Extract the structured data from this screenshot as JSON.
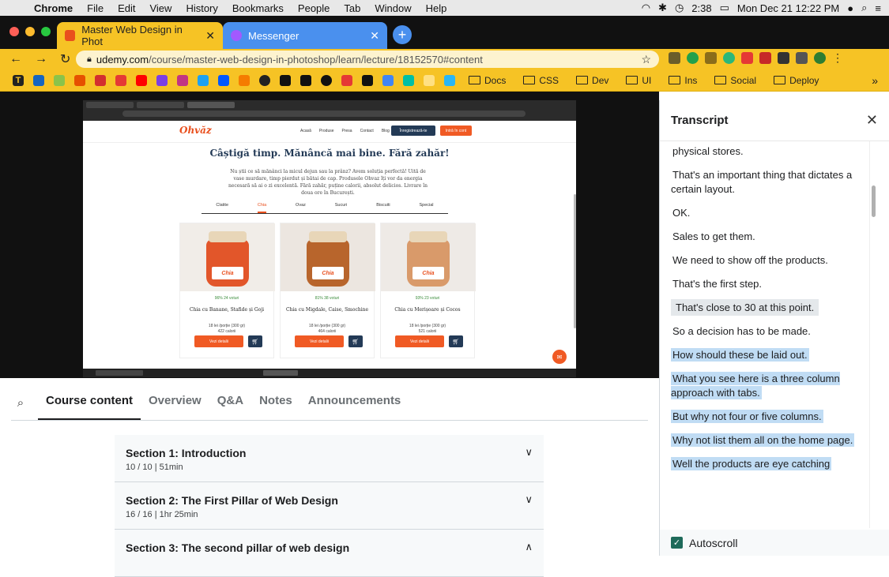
{
  "menubar": {
    "apple": "",
    "app": "Chrome",
    "items": [
      "File",
      "Edit",
      "View",
      "History",
      "Bookmarks",
      "People",
      "Tab",
      "Window",
      "Help"
    ],
    "time": "2:38",
    "datetime": "Mon Dec 21  12:22 PM"
  },
  "tabs": [
    {
      "title": "Master Web Design in Phot",
      "favicon_color": "#e94f1d",
      "active": true
    },
    {
      "title": "Messenger",
      "favicon_color": "#a259ff",
      "active": false
    }
  ],
  "new_tab_label": "+",
  "address": {
    "host": "udemy.com",
    "path": "/course/master-web-design-in-photoshop/learn/lecture/18152570#content"
  },
  "bookmarks": {
    "first_letter": "T",
    "folders": [
      "Docs",
      "CSS",
      "Dev",
      "UI",
      "Ins",
      "Social",
      "Deploy"
    ]
  },
  "video": {
    "logo": "Ohvăz",
    "nav": [
      "Acasă",
      "Produse",
      "Presa",
      "Contact",
      "Blog"
    ],
    "btn_register": "Înregistrează-te",
    "btn_login": "Intră în cont",
    "hero": "Câștigă timp. Mănâncă mai bine. Fără zahăr!",
    "sub": "Nu știi ce să mănânci la micul dejun sau la prânz? Avem soluția perfectă! Uită de vase murdare, timp pierdut și bătai de cap. Produsele Ohvaz îți vor da energia necesară să ai o zi excelentă. Fără zahăr, puține calorii, absolut delicios. Livrare în doua ore în București.",
    "tabs": [
      "Clatite",
      "Chia",
      "Ovaz",
      "Sucuri",
      "Biscuiti",
      "Special"
    ],
    "active_tab": "Chia",
    "cards": [
      {
        "label": "Chia",
        "rating": "96%",
        "votes": "24 voturi",
        "name": "Chia cu Banane, Stafide și Goji",
        "price": "18 lei /porție (300 gr)",
        "kcal": "422 calorii",
        "cta": "Vezi detalii",
        "jar_color": "#e2562a"
      },
      {
        "label": "Chia",
        "rating": "81%",
        "votes": "38 voturi",
        "name": "Chia cu Migdale, Caise, Smochine",
        "price": "18 lei /porție (300 gr)",
        "kcal": "464 calorii",
        "cta": "Vezi detalii",
        "jar_color": "#b8652c"
      },
      {
        "label": "Chia",
        "rating": "93%",
        "votes": "23 voturi",
        "name": "Chia cu Merișoare și Cocos",
        "price": "18 lei /porție (300 gr)",
        "kcal": "521 calorii",
        "cta": "Vezi detalii",
        "jar_color": "#d99a6a"
      }
    ]
  },
  "course_tabs": [
    "Course content",
    "Overview",
    "Q&A",
    "Notes",
    "Announcements"
  ],
  "sections": [
    {
      "title": "Section 1: Introduction",
      "meta": "10 / 10 | 51min",
      "chevron": "∨"
    },
    {
      "title": "Section 2: The First Pillar of Web Design",
      "meta": "16 / 16 | 1hr 25min",
      "chevron": "∨"
    },
    {
      "title": "Section 3: The second pillar of web design",
      "meta": "",
      "chevron": "∧"
    }
  ],
  "transcript": {
    "title": "Transcript",
    "close": "✕",
    "cues": [
      {
        "text": "physical stores.",
        "state": "normal"
      },
      {
        "text": "That's an important thing that dictates a certain layout.",
        "state": "normal"
      },
      {
        "text": "OK.",
        "state": "normal"
      },
      {
        "text": "Sales to get them.",
        "state": "normal"
      },
      {
        "text": "We need to show off the products.",
        "state": "normal"
      },
      {
        "text": "That's the first step.",
        "state": "normal"
      },
      {
        "text": "That's close to 30 at this point.",
        "state": "current"
      },
      {
        "text": "So a decision has to be made.",
        "state": "normal"
      },
      {
        "text": "How should these be laid out.",
        "state": "hl"
      },
      {
        "text": "What you see here is a three column approach with tabs.",
        "state": "hl"
      },
      {
        "text": "But why not four or five columns.",
        "state": "hl"
      },
      {
        "text": "Why not list them all on the home page.",
        "state": "hl"
      },
      {
        "text": "Well the products are eye catching",
        "state": "hl"
      }
    ],
    "autoscroll_label": "Autoscroll",
    "autoscroll_checked": true
  }
}
